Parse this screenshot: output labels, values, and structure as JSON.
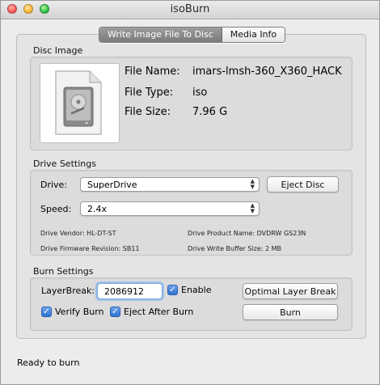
{
  "window": {
    "title": "isoBurn"
  },
  "tabs": [
    {
      "label": "Write Image File To Disc",
      "active": true
    },
    {
      "label": "Media Info",
      "active": false
    }
  ],
  "disc_image": {
    "section_label": "Disc Image",
    "icon": "disc-image-document-icon",
    "file_name_label": "File Name:",
    "file_name": "imars-lmsh-360_X360_HACK",
    "file_type_label": "File Type:",
    "file_type": "iso",
    "file_size_label": "File Size:",
    "file_size": "7.96 G"
  },
  "drive_settings": {
    "section_label": "Drive Settings",
    "drive_label": "Drive:",
    "drive_value": "SuperDrive",
    "eject_button": "Eject Disc",
    "speed_label": "Speed:",
    "speed_value": "2.4x",
    "vendor": "Drive Vendor: HL-DT-ST",
    "product": "Drive Product Name: DVDRW  GS23N",
    "firmware": "Drive Firmware Revision: SB11",
    "buffer": "Drive Write Buffer Size: 2 MB"
  },
  "burn_settings": {
    "section_label": "Burn Settings",
    "layerbreak_label": "LayerBreak:",
    "layerbreak_value": "2086912",
    "enable_label": "Enable",
    "optimal_button": "Optimal Layer Break",
    "verify_label": "Verify Burn",
    "eject_after_label": "Eject After Burn",
    "burn_button": "Burn",
    "enable_checked": true,
    "verify_checked": true,
    "eject_after_checked": true
  },
  "status": {
    "text": "Ready to burn"
  },
  "colors": {
    "accent": "#3b82e0",
    "checkbox": "#2f72d1",
    "panel": "#e4e4e4"
  }
}
